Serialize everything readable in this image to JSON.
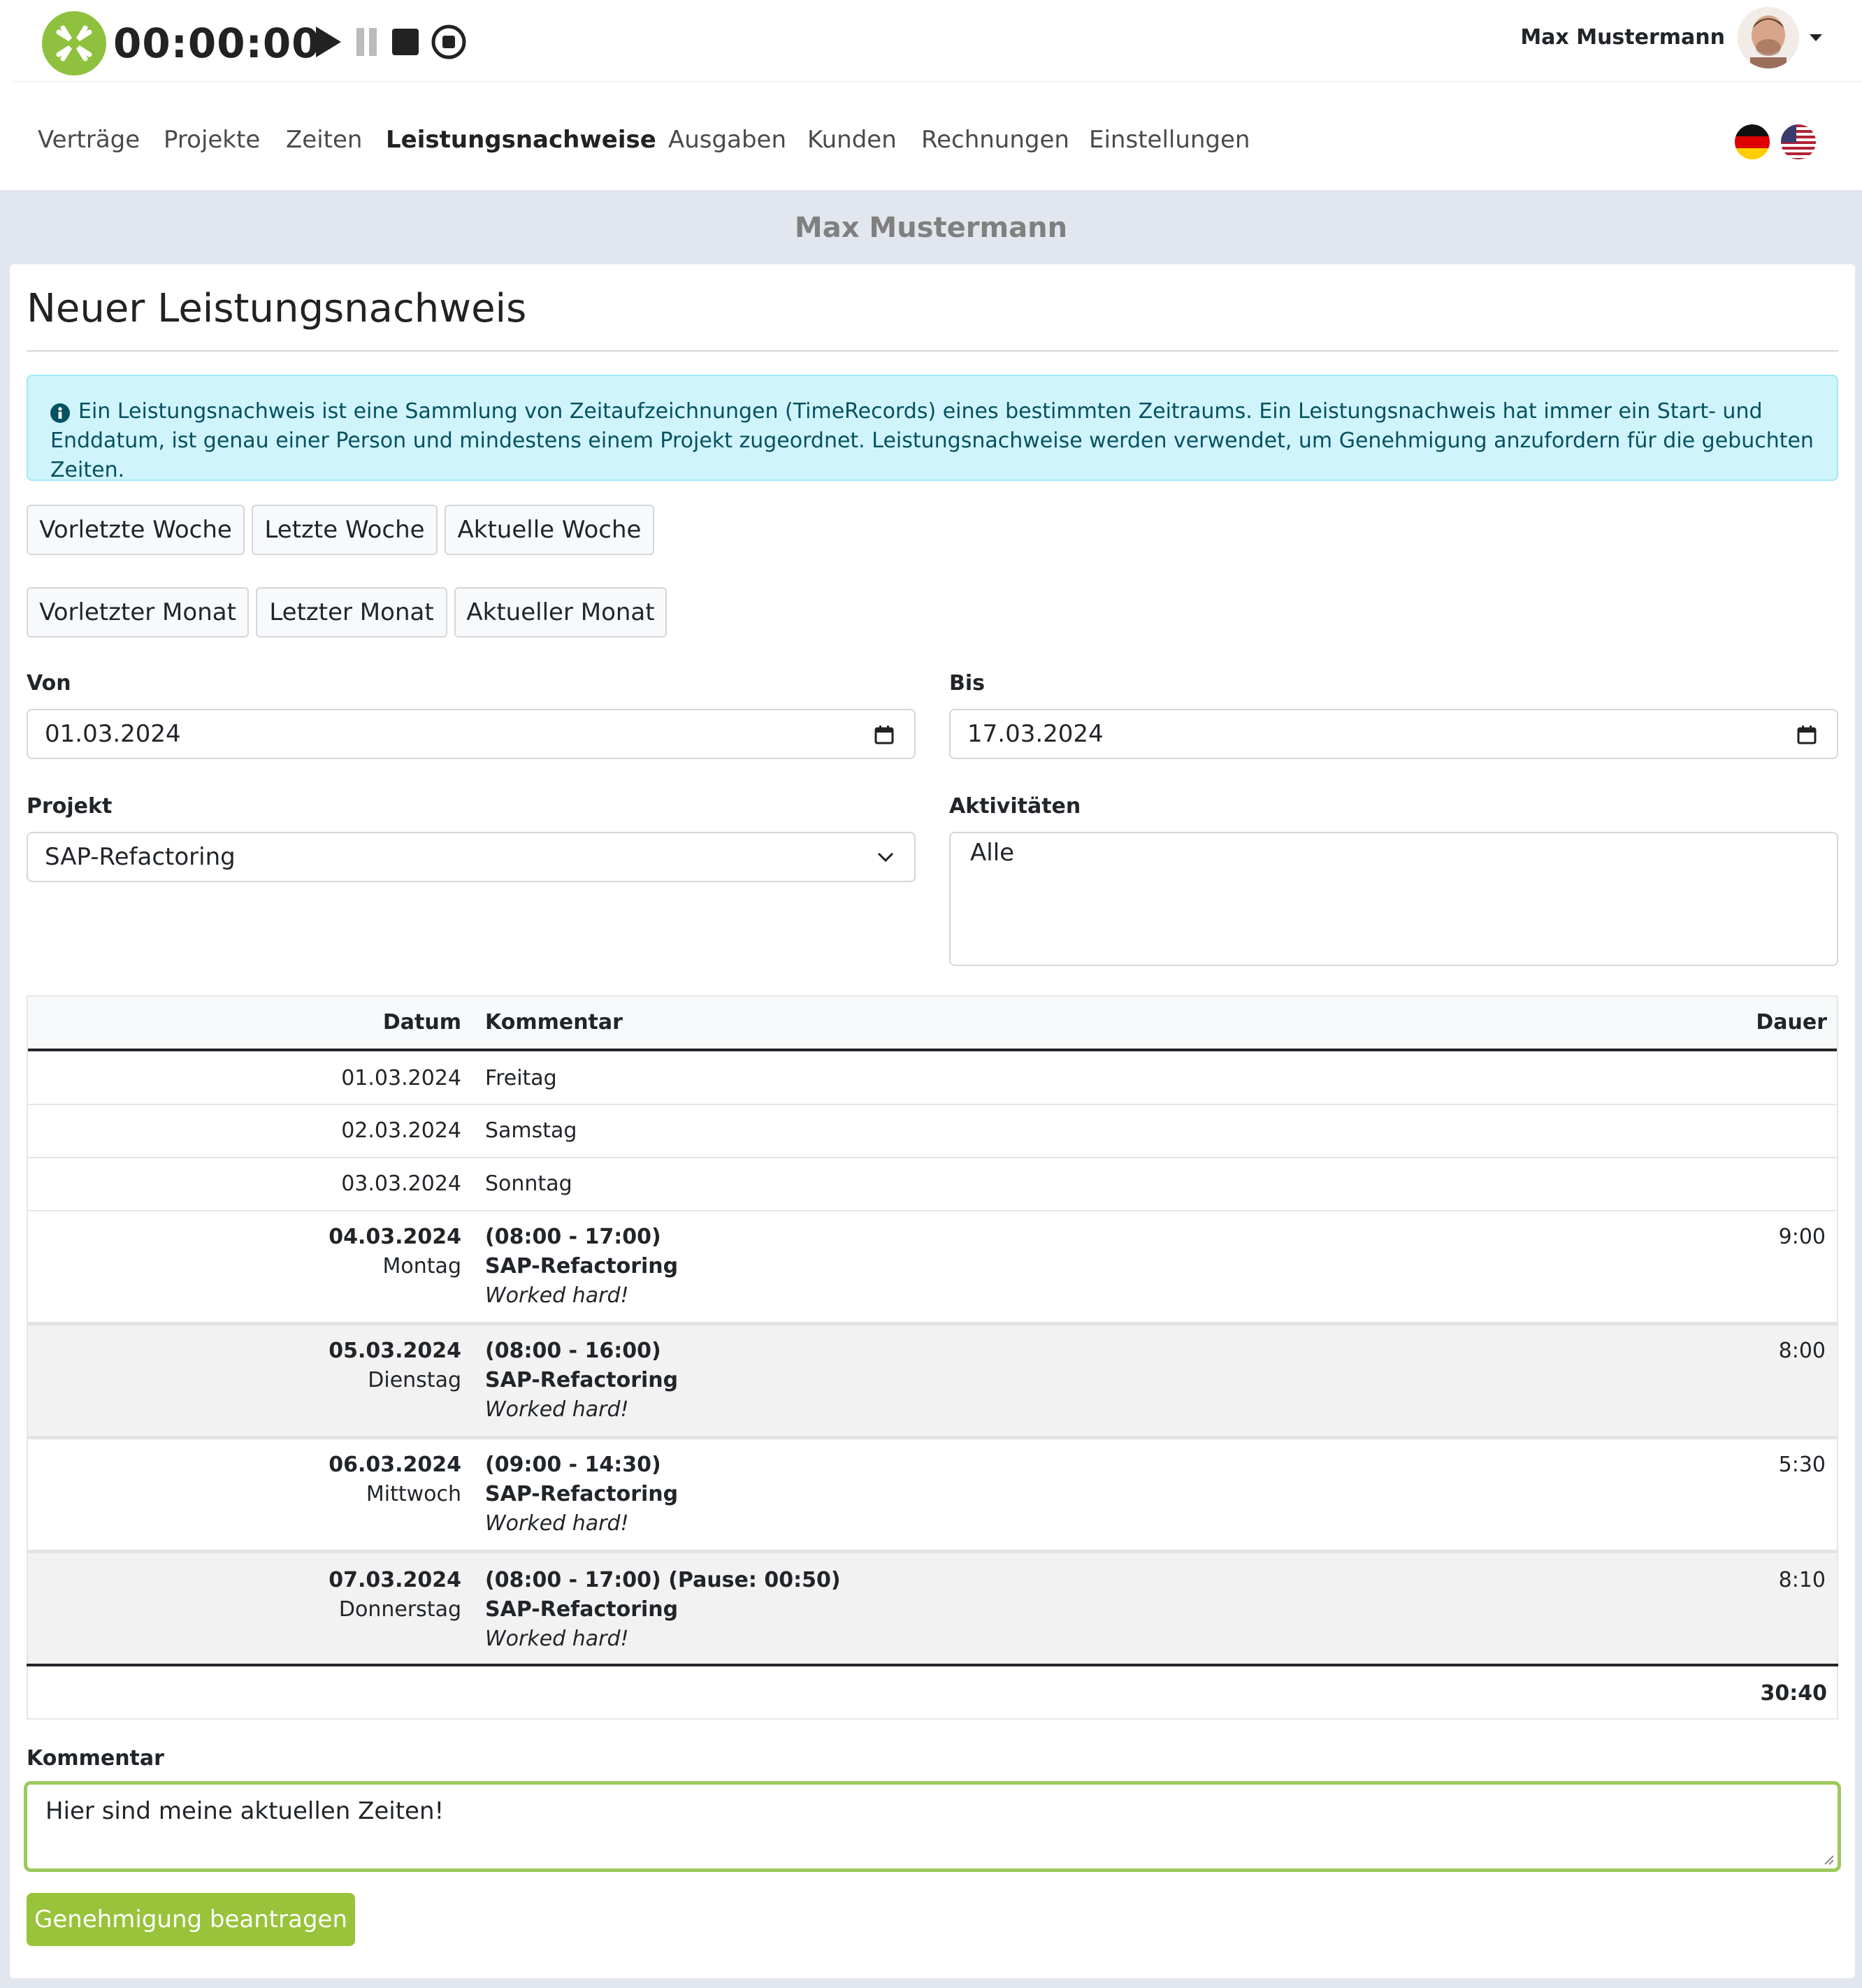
{
  "timer": {
    "display": "00:00:00",
    "controls": [
      "play-icon",
      "pause-icon",
      "stop-icon",
      "record-icon"
    ]
  },
  "user": {
    "name": "Max Mustermann"
  },
  "nav": {
    "items": [
      "Verträge",
      "Projekte",
      "Zeiten",
      "Leistungsnachweise",
      "Ausgaben",
      "Kunden",
      "Rechnungen",
      "Einstellungen"
    ],
    "active": "Leistungsnachweise",
    "languages": [
      "de-flag-icon",
      "us-flag-icon"
    ]
  },
  "page": {
    "band_title": "Max Mustermann",
    "title": "Neuer Leistungsnachweis",
    "info": "Ein Leistungsnachweis ist eine Sammlung von Zeitaufzeichnungen (TimeRecords) eines bestimmten Zeitraums. Ein Leistungsnachweis hat immer ein Start- und Enddatum, ist genau einer Person und mindestens einem Projekt zugeordnet. Leistungsnachweise werden verwendet, um Genehmigung anzufordern für die gebuchten Zeiten."
  },
  "quick_ranges": {
    "weeks": [
      "Vorletzte Woche",
      "Letzte Woche",
      "Aktuelle Woche"
    ],
    "months": [
      "Vorletzter Monat",
      "Letzter Monat",
      "Aktueller Monat"
    ]
  },
  "form": {
    "from_label": "Von",
    "from_value": "01.03.2024",
    "to_label": "Bis",
    "to_value": "17.03.2024",
    "project_label": "Projekt",
    "project_value": "SAP-Refactoring",
    "activities_label": "Aktivitäten",
    "activities_value": "Alle",
    "comment_label": "Kommentar",
    "comment_value": "Hier sind meine aktuellen Zeiten!",
    "submit_label": "Genehmigung beantragen"
  },
  "table": {
    "headers": {
      "date": "Datum",
      "comment": "Kommentar",
      "duration": "Dauer"
    },
    "simple_rows": [
      {
        "date": "01.03.2024",
        "day": "Freitag"
      },
      {
        "date": "02.03.2024",
        "day": "Samstag"
      },
      {
        "date": "03.03.2024",
        "day": "Sonntag"
      }
    ],
    "entries": [
      {
        "date": "04.03.2024",
        "weekday": "Montag",
        "time": "(08:00 - 17:00)",
        "project": "SAP-Refactoring",
        "note": "Worked hard!",
        "duration": "9:00"
      },
      {
        "date": "05.03.2024",
        "weekday": "Dienstag",
        "time": "(08:00 - 16:00)",
        "project": "SAP-Refactoring",
        "note": "Worked hard!",
        "duration": "8:00"
      },
      {
        "date": "06.03.2024",
        "weekday": "Mittwoch",
        "time": "(09:00 - 14:30)",
        "project": "SAP-Refactoring",
        "note": "Worked hard!",
        "duration": "5:30"
      },
      {
        "date": "07.03.2024",
        "weekday": "Donnerstag",
        "time": "(08:00 - 17:00) (Pause: 00:50)",
        "project": "SAP-Refactoring",
        "note": "Worked hard!",
        "duration": "8:10"
      }
    ],
    "total": "30:40"
  }
}
